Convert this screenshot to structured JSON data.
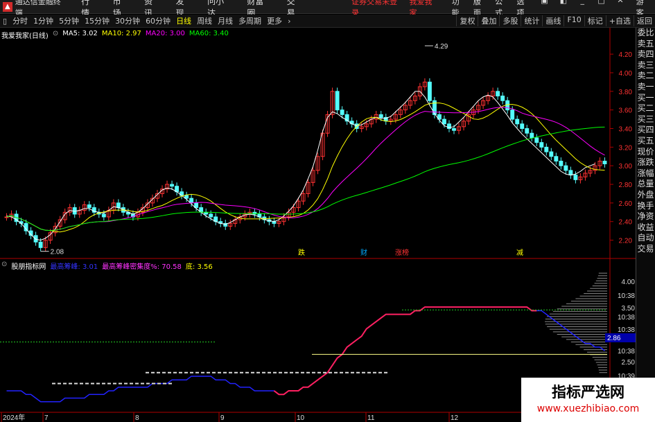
{
  "menubar": {
    "app_title": "通达信金融终端",
    "items": [
      "行情",
      "市场",
      "资讯",
      "发现",
      "问小达",
      "财富圈",
      "交易"
    ],
    "notice": "证券交易未登录",
    "notice_stock": "我爱我家",
    "right_items": [
      "功能",
      "版面",
      "公式",
      "选项"
    ],
    "user": "游客"
  },
  "toolbar": {
    "periods": [
      "分时",
      "1分钟",
      "5分钟",
      "15分钟",
      "30分钟",
      "60分钟",
      "日线",
      "周线",
      "月线",
      "多周期",
      "更多"
    ],
    "active": "日线",
    "right_items": [
      "复权",
      "叠加",
      "多股",
      "统计",
      "画线",
      "F10",
      "标记",
      "+自选",
      "返回"
    ]
  },
  "main_indicator": {
    "stock": "我爱我家(日线)",
    "ma5": "MA5: 3.02",
    "ma10": "MA10: 2.97",
    "ma20": "MA20: 3.00",
    "ma60": "MA60: 3.40",
    "ma5_color": "#ffffff",
    "ma10_color": "#ffff00",
    "ma20_color": "#ff00ff",
    "ma60_color": "#00ff00"
  },
  "price_axis": [
    "4.20",
    "4.00",
    "3.80",
    "3.60",
    "3.40",
    "3.20",
    "3.00",
    "2.80",
    "2.60",
    "2.40",
    "2.20"
  ],
  "high_label": "4.29",
  "low_label": "2.08",
  "event_labels": [
    {
      "text": "跌",
      "color": "#ffff00"
    },
    {
      "text": "财",
      "color": "#00aaff"
    },
    {
      "text": "涨榜",
      "color": "#ff3333"
    },
    {
      "text": "减",
      "color": "#ffff00"
    }
  ],
  "sub_indicator": {
    "name": "股朋指标网",
    "peak_label": "最高筹峰: 3.01",
    "density_label": "最高筹峰密集度%: 70.58",
    "bottom_label": "底: 3.56"
  },
  "sub_axis": [
    "4.00",
    "10:38",
    "3.50",
    "10:38",
    "10:38",
    "10:38",
    "2.86",
    "10:38",
    "2.50",
    "10:39",
    "10:39"
  ],
  "date_axis": [
    "2024年",
    "7",
    "8",
    "9",
    "10",
    "11",
    "12"
  ],
  "side_tabs": [
    "委比",
    "卖五",
    "卖四",
    "卖三",
    "卖二",
    "卖一",
    "买一",
    "买二",
    "买三",
    "买四",
    "买五",
    "现价",
    "涨跌",
    "涨幅",
    "总量",
    "外盘",
    "换手",
    "净资",
    "收益",
    "自动",
    "交易"
  ],
  "watermark": {
    "line1": "指标严选网",
    "line2": "www.xuezhibiao.com"
  },
  "chart_data": {
    "type": "line",
    "ylim": [
      2.1,
      4.35
    ],
    "close": [
      2.45,
      2.48,
      2.4,
      2.38,
      2.3,
      2.25,
      2.18,
      2.12,
      2.2,
      2.28,
      2.35,
      2.42,
      2.5,
      2.55,
      2.48,
      2.52,
      2.58,
      2.55,
      2.5,
      2.48,
      2.45,
      2.52,
      2.6,
      2.55,
      2.5,
      2.48,
      2.45,
      2.5,
      2.55,
      2.6,
      2.65,
      2.7,
      2.75,
      2.8,
      2.78,
      2.72,
      2.68,
      2.65,
      2.6,
      2.55,
      2.5,
      2.48,
      2.45,
      2.4,
      2.38,
      2.35,
      2.38,
      2.42,
      2.45,
      2.48,
      2.5,
      2.48,
      2.45,
      2.42,
      2.4,
      2.38,
      2.4,
      2.45,
      2.5,
      2.55,
      2.62,
      2.7,
      2.82,
      2.95,
      3.1,
      3.35,
      3.55,
      3.8,
      3.6,
      3.55,
      3.48,
      3.45,
      3.4,
      3.42,
      3.45,
      3.5,
      3.55,
      3.52,
      3.48,
      3.5,
      3.55,
      3.6,
      3.65,
      3.7,
      3.75,
      3.85,
      3.9,
      3.7,
      3.55,
      3.5,
      3.45,
      3.4,
      3.38,
      3.42,
      3.48,
      3.55,
      3.6,
      3.65,
      3.7,
      3.75,
      3.8,
      3.75,
      3.7,
      3.6,
      3.5,
      3.45,
      3.4,
      3.35,
      3.3,
      3.25,
      3.2,
      3.15,
      3.1,
      3.05,
      3.0,
      2.95,
      2.9,
      2.85,
      2.88,
      2.92,
      2.95,
      3.0,
      3.05,
      3.02
    ],
    "ma5": [
      2.46,
      2.45,
      2.42,
      2.38,
      2.32,
      2.26,
      2.21,
      2.2,
      2.22,
      2.26,
      2.32,
      2.4,
      2.48,
      2.52,
      2.51,
      2.52,
      2.54,
      2.54,
      2.51,
      2.5,
      2.49,
      2.52,
      2.56,
      2.55,
      2.53,
      2.5,
      2.48,
      2.5,
      2.54,
      2.59,
      2.64,
      2.69,
      2.74,
      2.76,
      2.75,
      2.72,
      2.68,
      2.64,
      2.59,
      2.54,
      2.5,
      2.46,
      2.43,
      2.4,
      2.38,
      2.37,
      2.39,
      2.42,
      2.45,
      2.47,
      2.48,
      2.47,
      2.45,
      2.42,
      2.41,
      2.4,
      2.42,
      2.46,
      2.51,
      2.57,
      2.65,
      2.74,
      2.86,
      2.99,
      3.17,
      3.37,
      3.52,
      3.58,
      3.56,
      3.52,
      3.49,
      3.45,
      3.43,
      3.44,
      3.47,
      3.5,
      3.52,
      3.51,
      3.51,
      3.53,
      3.58,
      3.63,
      3.68,
      3.74,
      3.8,
      3.8,
      3.74,
      3.65,
      3.56,
      3.49,
      3.43,
      3.41,
      3.42,
      3.47,
      3.52,
      3.58,
      3.64,
      3.7,
      3.74,
      3.76,
      3.74,
      3.68,
      3.61,
      3.54,
      3.46,
      3.4,
      3.34,
      3.29,
      3.24,
      3.19,
      3.14,
      3.09,
      3.04,
      2.99,
      2.94,
      2.91,
      2.9,
      2.91,
      2.94,
      2.98,
      3.0,
      3.02
    ]
  }
}
